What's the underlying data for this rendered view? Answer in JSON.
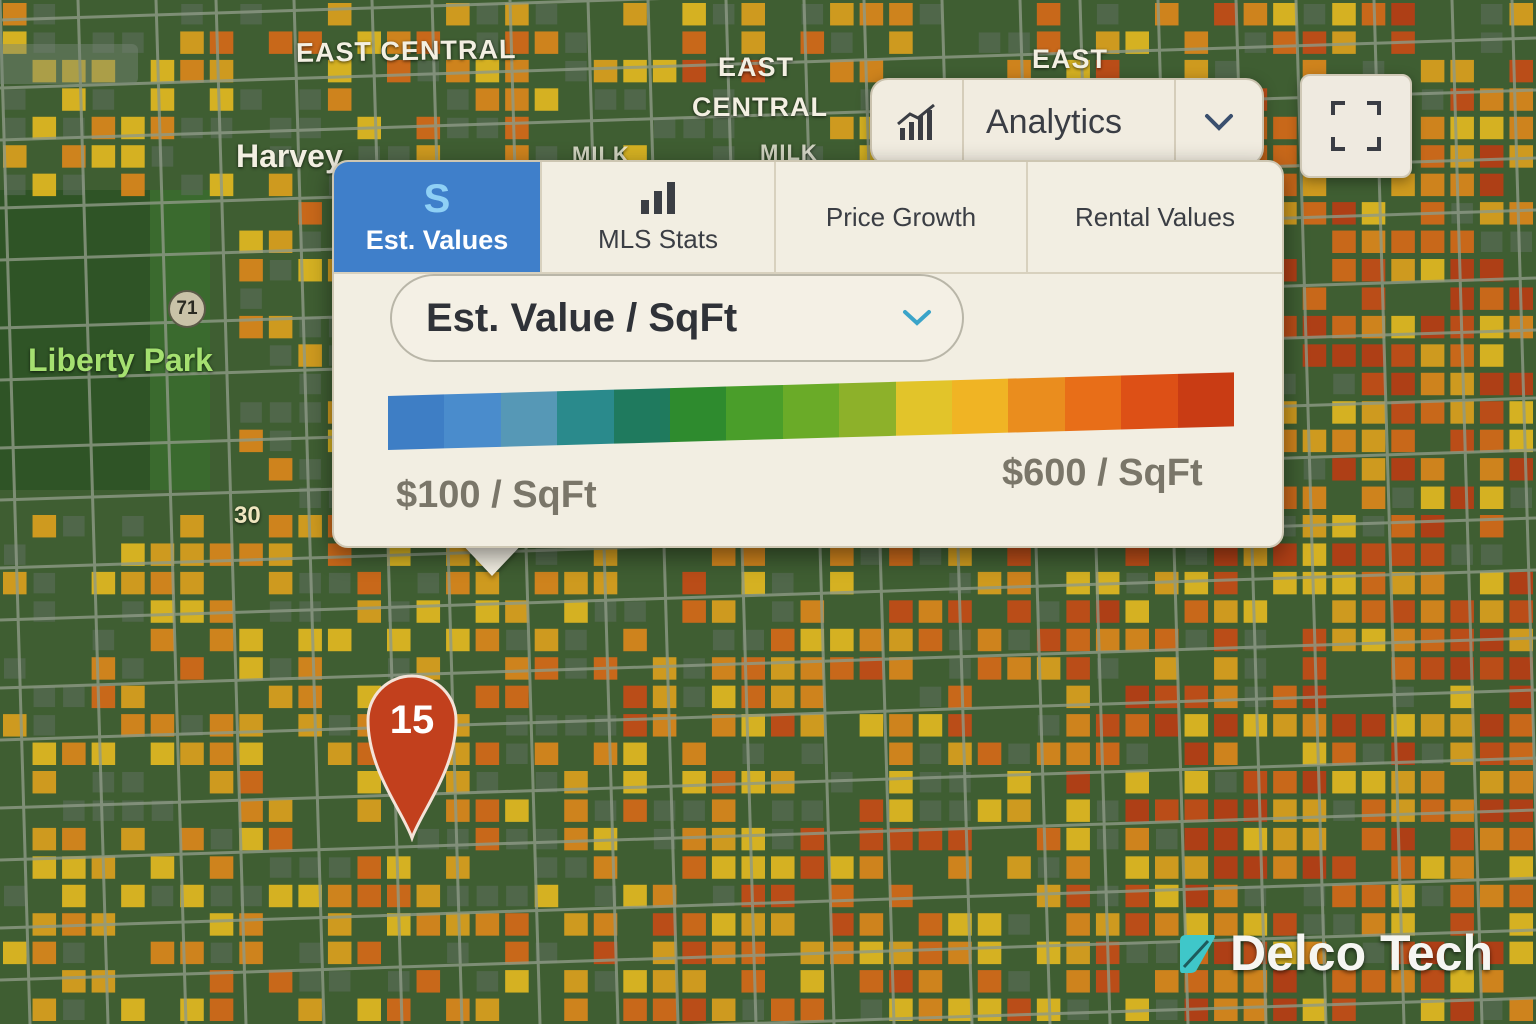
{
  "map": {
    "labels": {
      "east_central_1": "EAST CENTRAL",
      "east_central_2_line1": "EAST",
      "east_central_2_line2": "CENTRAL",
      "east": "EAST",
      "harvey": "Harvey",
      "milk_1": "MILK",
      "milk_2": "MILK",
      "liberty_park": "Liberty Park"
    },
    "routes": {
      "shield": "71",
      "plain": "30"
    },
    "marker": {
      "label": "15",
      "color": "#c2401d"
    },
    "land_color": "#3f5e32",
    "road_color": "#8e9a86"
  },
  "analytics": {
    "icon": "bar-chart-trend-icon",
    "label": "Analytics",
    "chevron": "chevron-down-icon"
  },
  "fullscreen": {
    "icon": "fullscreen-icon"
  },
  "panel": {
    "tabs": [
      {
        "icon": "dollar-icon",
        "glyph": "S",
        "label": "Est. Values",
        "active": true
      },
      {
        "icon": "bar-chart-icon",
        "label": "MLS Stats",
        "active": false
      },
      {
        "label": "Price Growth",
        "active": false
      },
      {
        "label": "Rental Values",
        "active": false
      }
    ],
    "metric": {
      "selected": "Est. Value / SqFt",
      "chevron": "chevron-down-icon"
    },
    "legend": {
      "min_label": "$100 / SqFt",
      "max_label": "$600 / SqFt",
      "colors": [
        "#3e7ec5",
        "#4a8ccc",
        "#5698b6",
        "#2a8a8c",
        "#1f7a5e",
        "#2e8b2e",
        "#4a9e2a",
        "#6aab28",
        "#8db12a",
        "#e2c42a",
        "#f0b424",
        "#ea8d1e",
        "#e86e18",
        "#dd5016",
        "#c93c14"
      ]
    }
  },
  "brand": {
    "name": "Delco Tech",
    "icon": "delco-leaf-icon",
    "icon_color": "#3fc7c9"
  }
}
